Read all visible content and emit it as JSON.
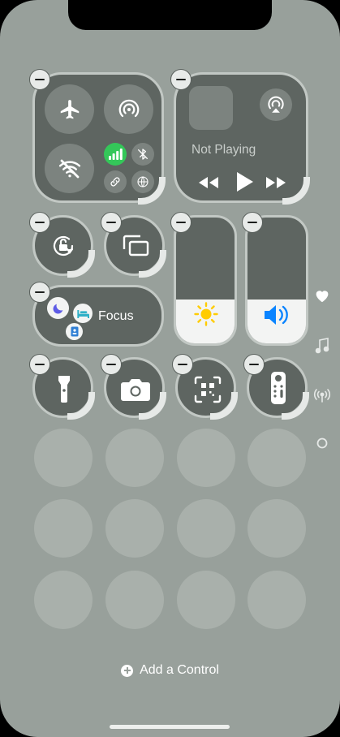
{
  "media": {
    "status": "Not Playing"
  },
  "focus": {
    "label": "Focus"
  },
  "footer": {
    "add_control_label": "Add a Control"
  },
  "slider_levels": {
    "brightness": 0.35,
    "volume": 0.35
  },
  "colors": {
    "background": "#98A09B",
    "tile": "#5E6561",
    "cellular_active": "#34C759",
    "focus_moon": "#5E5CE6",
    "focus_bed": "#30B0C7",
    "focus_work": "#2F7FD4",
    "brightness_icon": "#FFCC00",
    "volume_icon": "#0A84FF"
  },
  "icons": {
    "side_pages": [
      "heart-icon",
      "music-note-icon",
      "antenna-icon",
      "circle-icon"
    ]
  }
}
